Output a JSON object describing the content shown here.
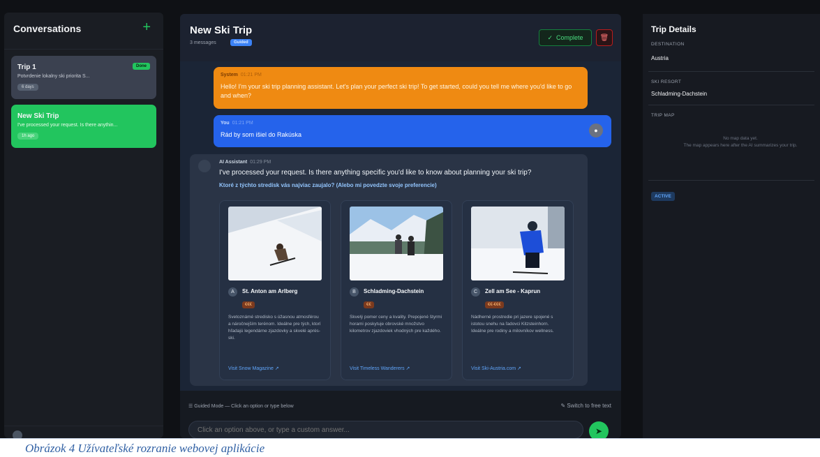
{
  "sidebar": {
    "title": "Conversations",
    "new_icon": "plus-icon",
    "items": [
      {
        "title": "Trip 1",
        "preview": "Potvrdenie lokalny ski priorita S...",
        "time": "6 days",
        "badge": "Done"
      },
      {
        "title": "New Ski Trip",
        "preview": "I've processed your request. Is there anythin...",
        "time": "1h ago"
      }
    ]
  },
  "main": {
    "title": "New Ski Trip",
    "subtitle": "3 messages",
    "mode_badge": "Guided",
    "complete_label": "Complete",
    "messages": {
      "system": {
        "sender": "System",
        "time": "01:21 PM",
        "text": "Hello! I'm your ski trip planning assistant. Let's plan your perfect ski trip! To get started, could you tell me where you'd like to go and when?"
      },
      "user": {
        "sender": "You",
        "time": "01:21 PM",
        "text": "Rád by som išiel do Rakúska"
      },
      "assistant": {
        "sender": "AI Assistant",
        "time": "01:29 PM",
        "text": "I've processed your request. Is there anything specific you'd like to know about planning your ski trip?",
        "question": "Ktoré z týchto stredísk vás najviac zaujalo? (Alebo mi povedzte svoje preferencie)",
        "options": [
          {
            "letter": "A",
            "name": "St. Anton am Arlberg",
            "price": "€€€",
            "description": "Svetoznámé stredisko s úžasnou atmosférou a náročnejším terénom. Ideálne pre tých, ktorí hľadajú legendárne zjazdovky a skvelé après-ski.",
            "link": "Visit Snow Magazine"
          },
          {
            "letter": "B",
            "name": "Schladming-Dachstein",
            "price": "€€",
            "description": "Skvelý pomer ceny a kvality. Prepojené štyrmi horami poskytuje obrovské množstvo kilometrov zjazdoviek vhodných pre každého.",
            "link": "Visit Timeless Wanderers"
          },
          {
            "letter": "C",
            "name": "Zell am See - Kaprun",
            "price": "€€-€€€",
            "description": "Nádherné prostredie pri jazere spojené s istotou snehu na ľadovci Kitzsteinhorn. Ideálne pre rodiny a milovníkov wellness.",
            "link": "Visit Ski-Austria.com"
          }
        ]
      }
    },
    "guided_hint": "Guided Mode — Click an option or type below",
    "switch_label": "Switch to free text",
    "input_placeholder": "Click an option above, or type a custom answer..."
  },
  "details": {
    "title": "Trip Details",
    "destination_label": "DESTINATION",
    "destination_value": "Austria",
    "resort_label": "SKI RESORT",
    "resort_value": "Schladming-Dachstein",
    "map_label": "TRIP MAP",
    "map_empty_1": "No map data yet.",
    "map_empty_2": "The map appears here after the AI summarizes your trip.",
    "status": "ACTIVE"
  },
  "caption": "Obrázok 4 Užívateľské rozranie webovej aplikácie",
  "colors": {
    "accent": "#22c55e",
    "system_bubble": "#ef8a12",
    "user_bubble": "#2563eb",
    "link": "#60a5fa"
  }
}
